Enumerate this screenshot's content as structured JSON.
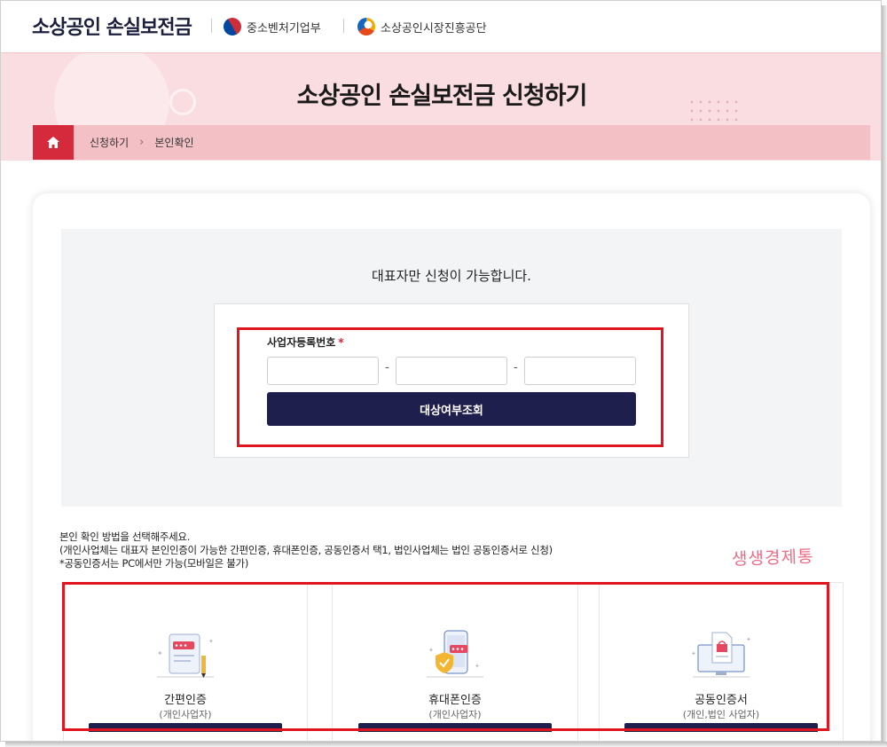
{
  "header": {
    "brand": "소상공인 손실보전금",
    "org1": {
      "name": "중소벤처기업부",
      "icon": "taeguk-logo-icon"
    },
    "org2": {
      "name": "소상공인시장진흥공단",
      "icon": "semas-logo-icon"
    }
  },
  "banner": {
    "title": "소상공인 손실보전금 신청하기"
  },
  "breadcrumb": {
    "home_icon": "home-icon",
    "items": [
      "신청하기",
      "본인확인"
    ]
  },
  "form": {
    "message": "대표자만 신청이 가능합니다.",
    "label": "사업자등록번호",
    "required_mark": "*",
    "fields": [
      {
        "value": "",
        "placeholder": ""
      },
      {
        "value": "",
        "placeholder": ""
      },
      {
        "value": "",
        "placeholder": ""
      }
    ],
    "separator": "-",
    "button": "대상여부조회"
  },
  "methods_info": {
    "line1": "본인 확인 방법을 선택해주세요.",
    "line2": "(개인사업체는 대표자 본인인증이 가능한 간편인증, 휴대폰인증, 공동인증서 택1, 법인사업체는 법인 공동인증서로 신청)",
    "line3": "*공동인증서는 PC에서만 가능(모바일은 불가)"
  },
  "watermark": "생생경제통",
  "methods": [
    {
      "name": "간편인증",
      "sub": "(개인사업자)",
      "icon": "simple-auth-icon"
    },
    {
      "name": "휴대폰인증",
      "sub": "(개인사업자)",
      "icon": "phone-auth-icon"
    },
    {
      "name": "공동인증서",
      "sub": "(개인,법인 사업자)",
      "icon": "certificate-icon"
    }
  ],
  "colors": {
    "accent": "#d42a3c",
    "navy": "#1e1f4c",
    "banner": "#f9dde0",
    "highlight": "#e0151f"
  }
}
